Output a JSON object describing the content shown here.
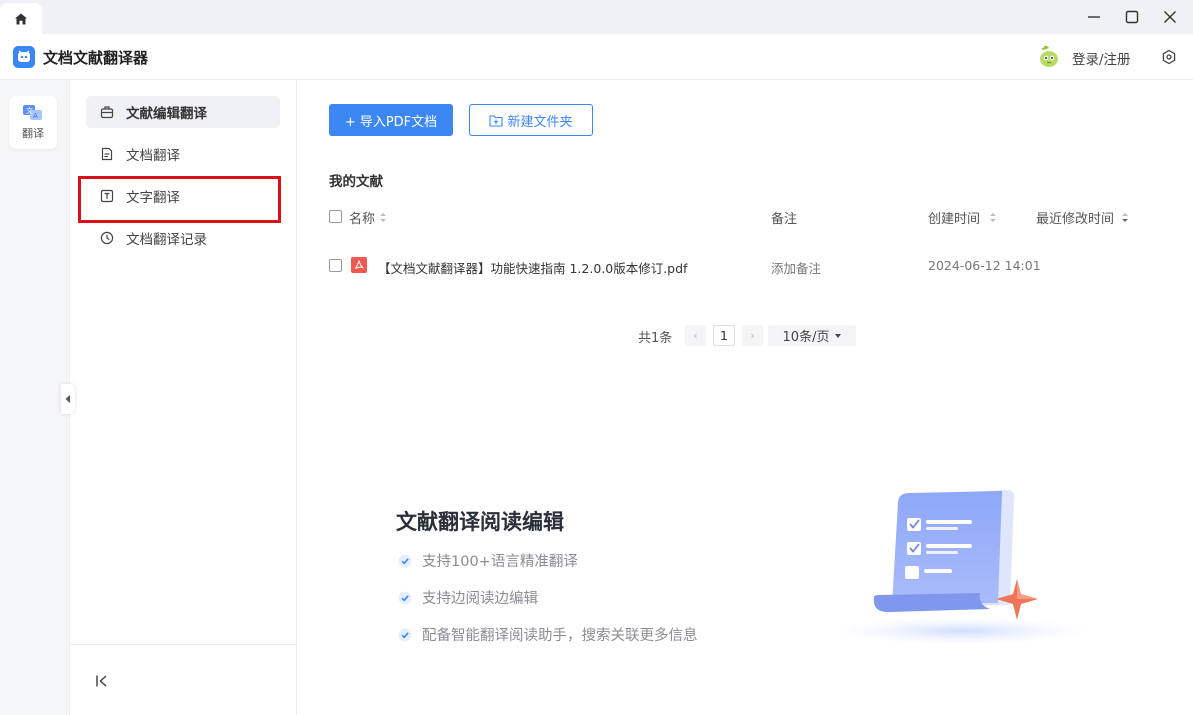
{
  "app": {
    "title": "文档文献翻译器"
  },
  "header": {
    "login_label": "登录/注册"
  },
  "rail": {
    "translate_label": "翻译"
  },
  "sidebar": {
    "items": [
      {
        "label": "文献编辑翻译"
      },
      {
        "label": "文档翻译"
      },
      {
        "label": "文字翻译"
      },
      {
        "label": "文档翻译记录"
      }
    ]
  },
  "toolbar": {
    "import_label": "+ 导入PDF文档",
    "new_folder_label": "新建文件夹"
  },
  "list": {
    "title": "我的文献",
    "columns": {
      "name": "名称",
      "note": "备注",
      "created": "创建时间",
      "modified": "最近修改时间"
    },
    "rows": [
      {
        "name": "【文档文献翻译器】功能快速指南 1.2.0.0版本修订.pdf",
        "note": "添加备注",
        "created": "2024-06-12 14:01"
      }
    ]
  },
  "pagination": {
    "total": "共1条",
    "prev": "‹",
    "next": "›",
    "page": "1",
    "page_size": "10条/页"
  },
  "promo": {
    "title": "文献翻译阅读编辑",
    "features": [
      "支持100+语言精准翻译",
      "支持边阅读边编辑",
      "配备智能翻译阅读助手，搜索关联更多信息"
    ]
  },
  "colors": {
    "primary": "#3d87f5",
    "highlight_border": "#d9101a",
    "pdf_icon": "#ee5a4f"
  }
}
